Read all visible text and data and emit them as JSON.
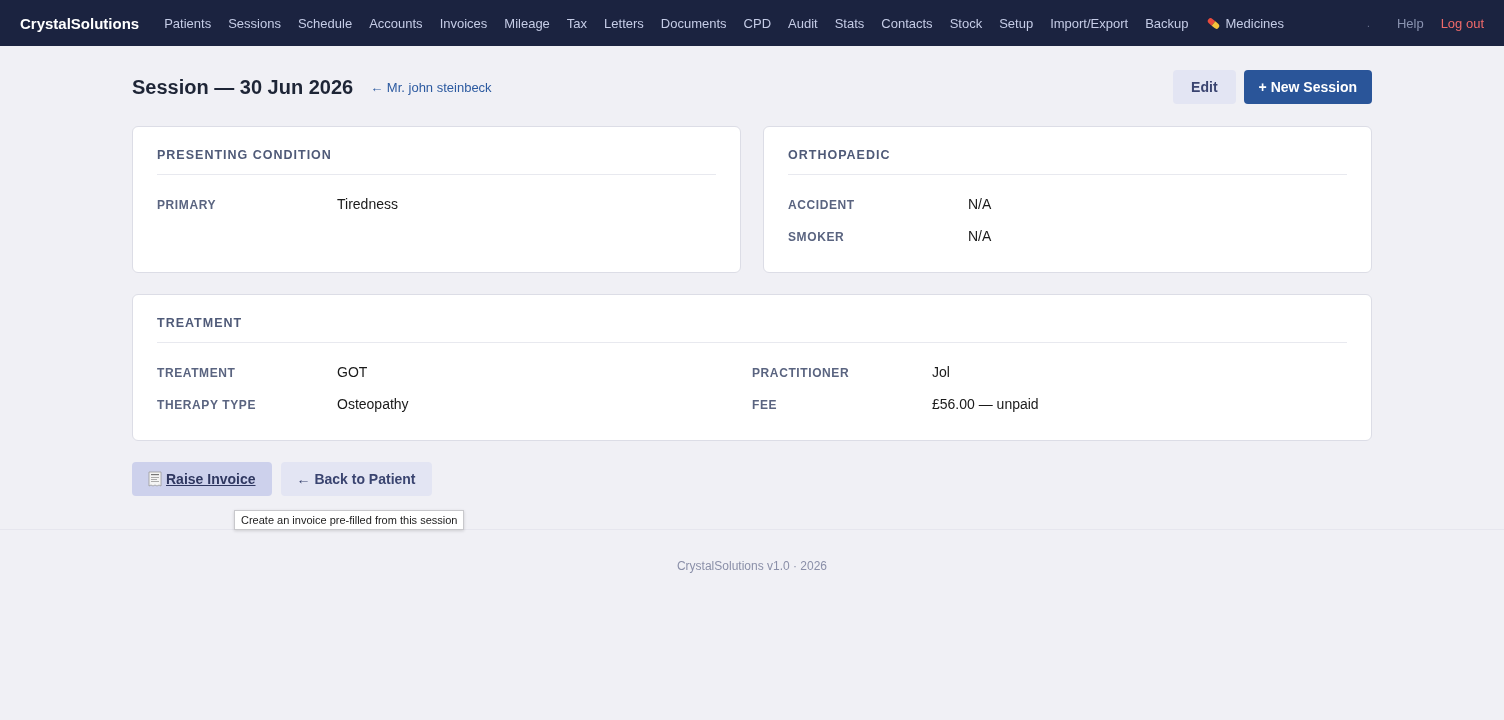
{
  "nav": {
    "brand": "CrystalSolutions",
    "items": [
      {
        "label": "Patients",
        "kind": "plain"
      },
      {
        "label": "Sessions",
        "kind": "plain"
      },
      {
        "label": "Schedule",
        "kind": "plain"
      },
      {
        "label": "Accounts",
        "kind": "plain"
      },
      {
        "label": "Invoices",
        "kind": "plain"
      },
      {
        "label": "Mileage",
        "kind": "plain"
      },
      {
        "label": "Tax",
        "kind": "plain"
      },
      {
        "label": "Letters",
        "kind": "plain"
      },
      {
        "label": "Documents",
        "kind": "plain"
      },
      {
        "label": "CPD",
        "kind": "plain"
      },
      {
        "label": "Audit",
        "kind": "plain"
      },
      {
        "label": "Stats",
        "kind": "plain"
      },
      {
        "label": "Contacts",
        "kind": "plain"
      },
      {
        "label": "Stock",
        "kind": "plain"
      },
      {
        "label": "Setup",
        "kind": "plain"
      },
      {
        "label": "Import/Export",
        "kind": "plain"
      },
      {
        "label": "Backup",
        "kind": "plain"
      },
      {
        "label": "Medicines",
        "kind": "pill"
      }
    ],
    "separator": ".",
    "help": "Help",
    "logout": "Log out"
  },
  "header": {
    "title": "Session — 30 Jun 2026",
    "back_link": "← Mr. john steinbeck",
    "buttons": [
      {
        "label": "Edit",
        "kind": "secondary"
      },
      {
        "label": "+ New Session",
        "kind": "primary"
      }
    ]
  },
  "panel_rows": [
    [
      {
        "title": "PRESENTING CONDITION",
        "columns": [
          [
            {
              "label": "PRIMARY",
              "value": "Tiredness"
            }
          ]
        ]
      },
      {
        "title": "ORTHOPAEDIC",
        "columns": [
          [
            {
              "label": "ACCIDENT",
              "value": "N/A"
            },
            {
              "label": "SMOKER",
              "value": "N/A"
            }
          ]
        ]
      }
    ],
    [
      {
        "title": "TREATMENT",
        "columns": [
          [
            {
              "label": "TREATMENT",
              "value": "GOT"
            },
            {
              "label": "THERAPY TYPE",
              "value": "Osteopathy"
            }
          ],
          [
            {
              "label": "PRACTITIONER",
              "value": "Jol"
            },
            {
              "label": "FEE",
              "value": "£56.00 — unpaid"
            }
          ]
        ]
      }
    ]
  ],
  "actions": [
    {
      "label": "Raise Invoice",
      "kind": "receipt",
      "hovered": true,
      "tooltip": "Create an invoice pre-filled from this session"
    },
    {
      "label": "← Back to Patient",
      "kind": "plain",
      "hovered": false
    }
  ],
  "footer": "CrystalSolutions v1.0 · 2026"
}
